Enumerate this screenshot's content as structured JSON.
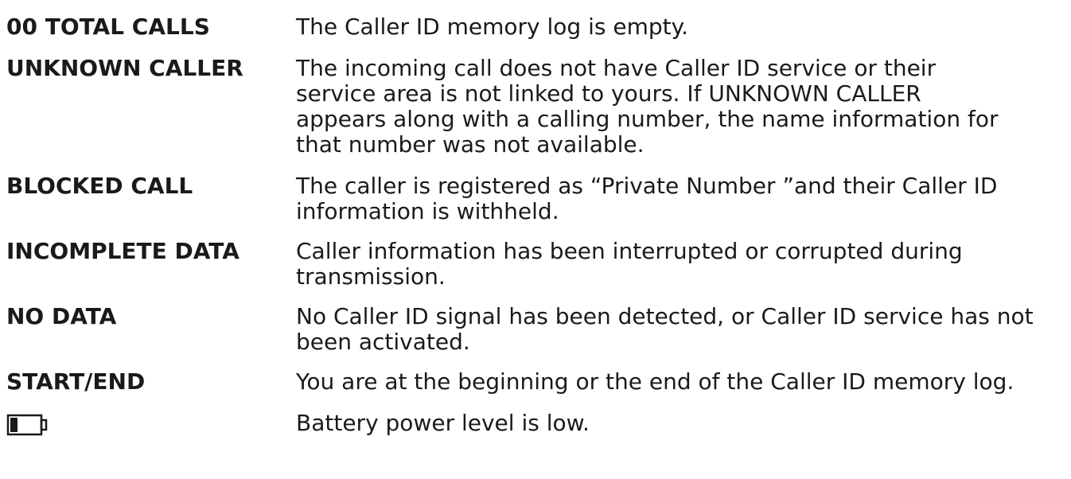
{
  "rows": [
    {
      "term": "00  TOTAL CALLS",
      "lines": [
        "The Caller ID memory log is empty."
      ]
    },
    {
      "term": "UNKNOWN CALLER",
      "lines": [
        "The incoming call does not have Caller ID service or their",
        "service area is not linked to yours. If UNKNOWN CALLER",
        "appears along with a calling number, the name information for",
        "that number was not available."
      ]
    },
    {
      "term": "BLOCKED CALL",
      "lines": [
        "The caller is registered as “Private Number ”and their Caller ID",
        "information is withheld."
      ]
    },
    {
      "term": "INCOMPLETE DATA",
      "lines": [
        "Caller information has been interrupted or corrupted during",
        "transmission."
      ]
    },
    {
      "term": "NO DATA",
      "lines": [
        "No Caller ID signal has been detected, or Caller ID service has not",
        "been activated."
      ]
    },
    {
      "term": "START/END",
      "lines": [
        "You are at the beginning or the end of the Caller ID memory log."
      ]
    },
    {
      "icon": "battery-low-icon",
      "lines": [
        "Battery power level is low."
      ]
    }
  ]
}
